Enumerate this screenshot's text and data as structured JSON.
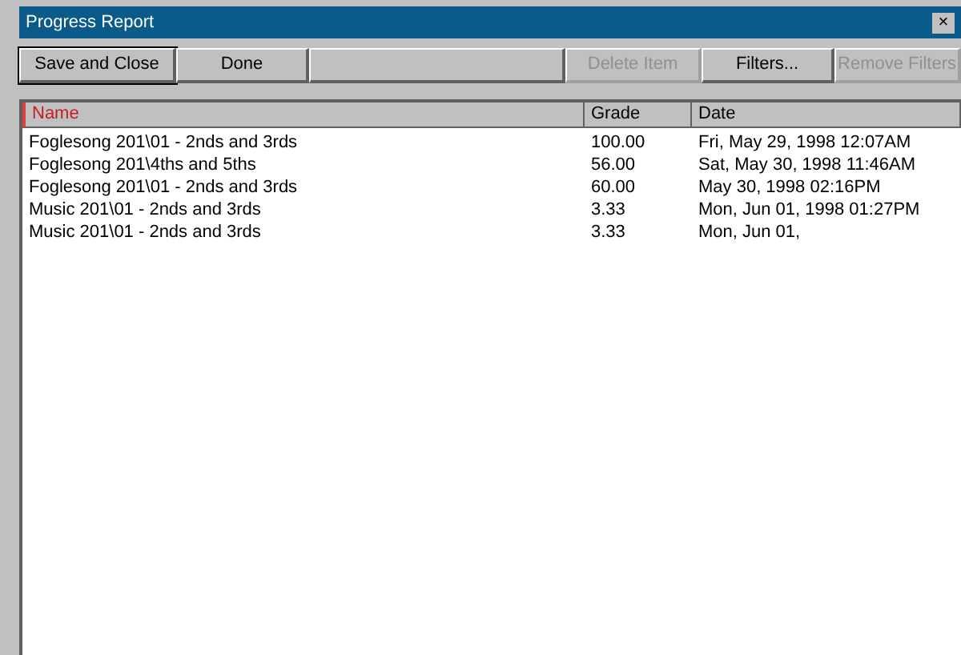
{
  "window": {
    "title": "Progress Report",
    "close": "×"
  },
  "toolbar": [
    {
      "label": "Save and Close",
      "disabled": false,
      "default": true
    },
    {
      "label": "Done",
      "disabled": false,
      "default": false
    },
    {
      "disabled": false,
      "default": false
    },
    {
      "label": "Delete Item",
      "disabled": true,
      "default": false
    },
    {
      "label": "Filters...",
      "disabled": false,
      "default": false
    },
    {
      "label": "Remove Filters",
      "disabled": true,
      "default": false
    }
  ],
  "table": {
    "columns": [
      {
        "label": "Name",
        "sorted": true
      },
      {
        "label": "Grade",
        "sorted": false
      },
      {
        "label": "Date",
        "sorted": false
      }
    ],
    "rows": [
      [
        "Foglesong 201\\01 - 2nds and 3rds",
        "100.00",
        "Fri, May 29, 1998 12:07AM"
      ],
      [
        "Foglesong 201\\4ths and 5ths",
        "56.00",
        "Sat, May 30, 1998 11:46AM"
      ],
      [
        "Foglesong 201\\01 - 2nds and 3rds",
        "60.00",
        "May 30, 1998 02:16PM"
      ],
      [
        "Music 201\\01 - 2nds and 3rds",
        "3.33",
        "Mon, Jun 01, 1998 01:27PM"
      ],
      [
        "Music 201\\01 - 2nds and 3rds",
        "3.33",
        "Mon, Jun 01,"
      ]
    ]
  }
}
